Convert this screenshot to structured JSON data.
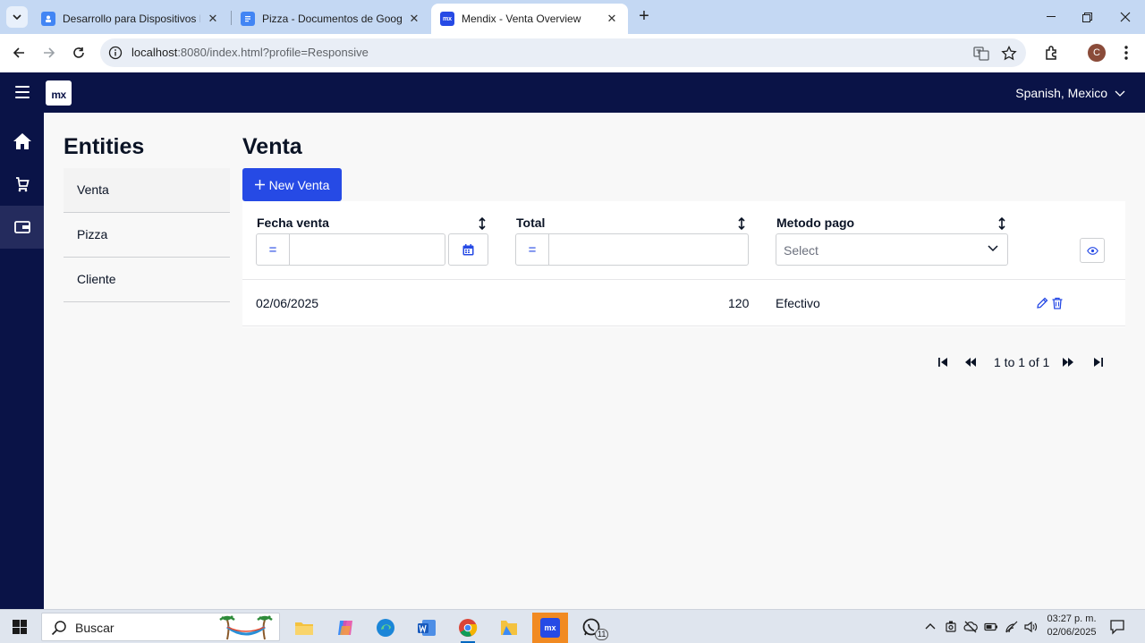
{
  "browser": {
    "tabs": [
      {
        "title": "Desarrollo para Dispositivos Int",
        "favicon_color": "#4285f4"
      },
      {
        "title": "Pizza - Documentos de Google",
        "favicon_color": "#4285f4"
      },
      {
        "title": "Mendix - Venta Overview",
        "favicon_color": "#264ae5",
        "active": true
      }
    ],
    "url_host": "localhost",
    "url_rest": ":8080/index.html?profile=Responsive",
    "profile_initial": "C"
  },
  "app": {
    "logo_text": "mx",
    "language": "Spanish, Mexico",
    "sidenav_icons": [
      "home-icon",
      "cart-icon",
      "wallet-icon"
    ],
    "entities_title": "Entities",
    "entities": [
      "Venta",
      "Pizza",
      "Cliente"
    ],
    "page_title": "Venta",
    "new_button": "New Venta",
    "columns": {
      "fecha": "Fecha venta",
      "total": "Total",
      "metodo": "Metodo pago"
    },
    "filter": {
      "equals_symbol": "=",
      "select_placeholder": "Select"
    },
    "rows": [
      {
        "fecha": "02/06/2025",
        "total": "120",
        "metodo": "Efectivo"
      }
    ],
    "pagination": "1 to 1 of 1"
  },
  "taskbar": {
    "search_placeholder": "Buscar",
    "whatsapp_badge": "11",
    "time": "03:27 p. m.",
    "date": "02/06/2025"
  },
  "colors": {
    "primary": "#264ae5",
    "navy": "#0a1347",
    "accent_orange": "#f18a22"
  }
}
